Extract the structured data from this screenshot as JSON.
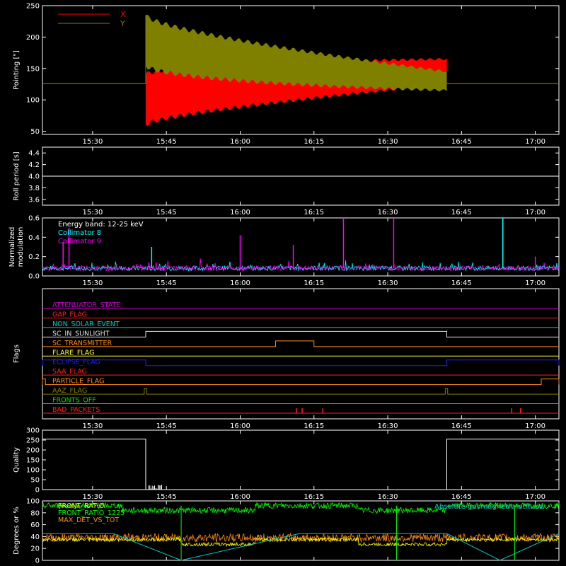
{
  "chart_data": [
    {
      "type": "line",
      "name_on_chart": "",
      "ylabel": "Pointing [\"]",
      "ylim": [
        45,
        250
      ],
      "yticks": [
        50,
        100,
        150,
        200,
        250
      ],
      "xlim": [
        15.33,
        17.08
      ],
      "xticks": [
        "15:30",
        "15:45",
        "16:00",
        "16:15",
        "16:30",
        "16:45",
        "17:00"
      ],
      "legend": {
        "placement": "top-left",
        "entries": [
          {
            "name": "X",
            "color": "#ff0000"
          },
          {
            "name": "Y",
            "color": "#808000"
          }
        ]
      },
      "series": [
        {
          "name": "X",
          "color": "#ff0000",
          "start": 15.68,
          "end": 16.7,
          "center_start": 100,
          "center_end": 145,
          "amp_start": 40,
          "amp_end": 20,
          "baseline": 126
        },
        {
          "name": "Y",
          "color": "#808000",
          "start": 15.68,
          "end": 16.7,
          "center_start": 195,
          "center_end": 130,
          "amp_start": 40,
          "amp_end": 15,
          "baseline": 126
        }
      ]
    },
    {
      "type": "line",
      "ylabel": "Roll period [s]",
      "ylim": [
        3.5,
        4.5
      ],
      "yticks": [
        3.6,
        3.8,
        4.0,
        4.2,
        4.4
      ],
      "xticks": [
        "15:30",
        "15:45",
        "16:00",
        "16:15",
        "16:30",
        "16:45",
        "17:00"
      ],
      "series": [
        {
          "name": "roll",
          "color": "#ffffff",
          "value": 4.0
        }
      ]
    },
    {
      "type": "line",
      "ylabel": "Normalized modulation",
      "ylim": [
        0,
        0.6
      ],
      "yticks": [
        0.0,
        0.2,
        0.4,
        0.6
      ],
      "xticks": [
        "15:30",
        "15:45",
        "16:00",
        "16:15",
        "16:30",
        "16:45",
        "17:00"
      ],
      "legend": {
        "placement": "top-left",
        "entries": [
          {
            "name": "Energy band: 12-25 keV",
            "color": "#ffffff"
          },
          {
            "name": "Collimator 8",
            "color": "#00ffff"
          },
          {
            "name": "Collimator 9",
            "color": "#ff00ff"
          }
        ]
      },
      "spikes": [
        {
          "t": 15.42,
          "v": 0.5,
          "color": "#ff00ff"
        },
        {
          "t": 15.4,
          "v": 0.35,
          "color": "#ff00ff"
        },
        {
          "t": 16.0,
          "v": 0.42,
          "color": "#ff00ff"
        },
        {
          "t": 16.35,
          "v": 0.6,
          "color": "#ff00ff"
        },
        {
          "t": 16.52,
          "v": 0.6,
          "color": "#ff00ff"
        },
        {
          "t": 16.18,
          "v": 0.32,
          "color": "#ff00ff"
        },
        {
          "t": 15.7,
          "v": 0.3,
          "color": "#00ffff"
        },
        {
          "t": 16.89,
          "v": 0.6,
          "color": "#00ffff"
        },
        {
          "t": 17.0,
          "v": 0.2,
          "color": "#ff00ff"
        }
      ],
      "baseline": 0.08
    },
    {
      "type": "table",
      "ylabel": "Flags",
      "xticks": [
        "15:30",
        "15:45",
        "16:00",
        "16:15",
        "16:30",
        "16:45",
        "17:00"
      ],
      "flags": [
        {
          "name": "ATTENUATOR_STATE",
          "color": "#c800c8",
          "steps": []
        },
        {
          "name": "GAP_FLAG",
          "color": "#ff2020",
          "steps": []
        },
        {
          "name": "NON_SOLAR_EVENT",
          "color": "#00c8c8",
          "steps": []
        },
        {
          "name": "SC_IN_SUNLIGHT",
          "color": "#e0e0e0",
          "steps": [
            [
              15.68,
              16.7
            ]
          ]
        },
        {
          "name": "SC_TRANSMITTER",
          "color": "#ff8c1a",
          "steps": [
            [
              16.12,
              16.25
            ]
          ]
        },
        {
          "name": "FLARE_FLAG",
          "color": "#ffff33",
          "steps": []
        },
        {
          "name": "ECLIPSE_FLAG",
          "color": "#2020ff",
          "steps": [
            [
              15.33,
              15.68
            ],
            [
              16.7,
              17.08
            ]
          ]
        },
        {
          "name": "SAA_FLAG",
          "color": "#ff2020",
          "steps": []
        },
        {
          "name": "PARTICLE_FLAG",
          "color": "#ff8c1a",
          "steps": [
            [
              15.33,
              15.34
            ],
            [
              17.02,
              17.08
            ]
          ]
        },
        {
          "name": "AAZ_FLAG",
          "color": "#808000",
          "steps": [
            [
              15.675,
              15.683
            ],
            [
              16.695,
              16.703
            ]
          ]
        },
        {
          "name": "FRONTS_OFF",
          "color": "#00e000",
          "steps": []
        },
        {
          "name": "BAD_PACKETS",
          "color": "#ff2020",
          "ticks": [
            16.19,
            16.21,
            16.28,
            16.92,
            16.95
          ]
        }
      ]
    },
    {
      "type": "line",
      "ylabel": "Quality",
      "ylim": [
        0,
        300
      ],
      "yticks": [
        0,
        50,
        100,
        150,
        200,
        250,
        300
      ],
      "xticks": [
        "15:30",
        "15:45",
        "16:00",
        "16:15",
        "16:30",
        "16:45",
        "17:00"
      ],
      "series": [
        {
          "name": "quality",
          "color": "#ffffff",
          "segments": [
            [
              15.33,
              15.68,
              255
            ],
            [
              15.68,
              16.7,
              0
            ],
            [
              16.7,
              17.08,
              255
            ]
          ]
        }
      ]
    },
    {
      "type": "line",
      "ylabel": "Degrees or %",
      "ylim": [
        0,
        100
      ],
      "yticks": [
        0,
        20,
        40,
        60,
        80,
        100
      ],
      "legend": {
        "placement": "top-left",
        "entries": [
          {
            "name": "FRONT_RATIO",
            "color": "#ffff00"
          },
          {
            "name": "FRONT_RATIO_1225",
            "color": "#00ff00"
          },
          {
            "name": "MAX_DET_VS_TOT",
            "color": "#ff8c1a"
          }
        ]
      },
      "annotation": {
        "text": "Absolute geomagnetic latitude",
        "color": "#00c8c8",
        "placement": "top-right"
      },
      "series": [
        {
          "name": "FRONT_RATIO_1225",
          "color": "#00ff00",
          "level": 92
        },
        {
          "name": "FRONT_RATIO",
          "color": "#ffff00",
          "level": 35
        },
        {
          "name": "MAX_DET_VS_TOT",
          "color": "#ff8c1a",
          "level": 38
        },
        {
          "name": "Absolute geomagnetic latitude",
          "color": "#00c8c8",
          "points": [
            [
              15.33,
              45
            ],
            [
              15.57,
              45
            ],
            [
              15.8,
              0
            ],
            [
              16.2,
              45
            ],
            [
              16.7,
              45
            ],
            [
              16.88,
              0
            ],
            [
              17.08,
              45
            ]
          ]
        }
      ]
    }
  ]
}
